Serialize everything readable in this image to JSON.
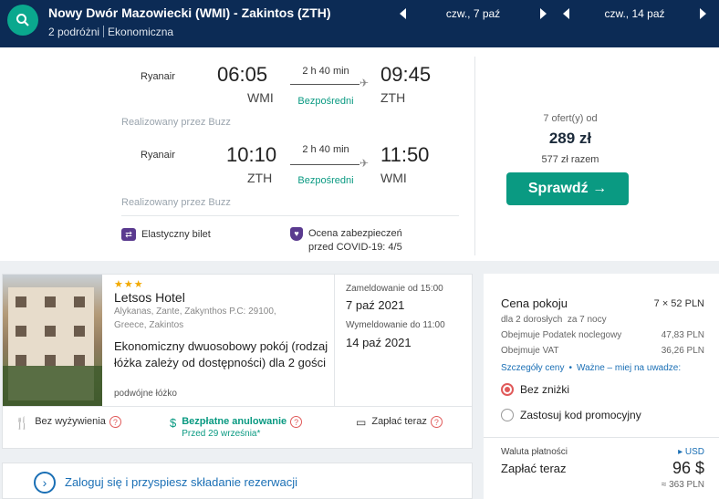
{
  "header": {
    "route": "Nowy Dwór Mazowiecki (WMI) - Zakintos (ZTH)",
    "travellers": "2 podróżni",
    "cabin": "Ekonomiczna",
    "depart_date": "czw., 7 paź",
    "return_date": "czw., 14 paź"
  },
  "flight": {
    "outbound": {
      "airline": "Ryanair",
      "dep_time": "06:05",
      "dep_code": "WMI",
      "duration": "2 h 40 min",
      "stops": "Bezpośredni",
      "arr_time": "09:45",
      "arr_code": "ZTH",
      "operated": "Realizowany przez Buzz"
    },
    "inbound": {
      "airline": "Ryanair",
      "dep_time": "10:10",
      "dep_code": "ZTH",
      "duration": "2 h 40 min",
      "stops": "Bezpośredni",
      "arr_time": "11:50",
      "arr_code": "WMI",
      "operated": "Realizowany przez Buzz"
    },
    "features": {
      "flexible": "Elastyczny bilet",
      "covid_line1": "Ocena zabezpieczeń",
      "covid_line2": "przed COVID-19: 4/5"
    },
    "offers": {
      "count": "7 ofert(y) od",
      "price": "289 zł",
      "total": "577 zł razem",
      "cta": "Sprawdź →"
    }
  },
  "hotel": {
    "stars": "★★★",
    "name": "Letsos Hotel",
    "address_line1": "Alykanas, Zante, Zakynthos P.C: 29100,",
    "address_line2": "Greece, Zakintos",
    "room": "Ekonomiczny dwuosobowy pokój (rodzaj łóżka zależy od dostępności) dla 2 gości",
    "bed": "podwójne łóżko",
    "checkin_label": "Zameldowanie od 15:00",
    "checkin_date": "7 paź 2021",
    "checkout_label": "Wymeldowanie do 11:00",
    "checkout_date": "14 paź 2021",
    "amenities": {
      "meals": "Bez wyżywienia",
      "cancel": "Bezpłatne anulowanie",
      "cancel_sub": "Przed 29 września*",
      "pay": "Zapłać teraz"
    }
  },
  "login": {
    "text": "Zaloguj się i przyspiesz składanie rezerwacji"
  },
  "price_panel": {
    "room_price_label": "Cena pokoju",
    "room_price_value": "7 × 52 PLN",
    "guests": "dla 2 dorosłych  za 7 nocy",
    "tax_label": "Obejmuje Podatek noclegowy",
    "tax_value": "47,83 PLN",
    "vat_label": "Obejmuje VAT",
    "vat_value": "36,26 PLN",
    "details_link": "Szczegóły ceny",
    "important_link": "Ważne – miej na uwadze:",
    "opt_no_discount": "Bez zniżki",
    "opt_promo": "Zastosuj kod promocyjny",
    "currency_label": "Waluta płatności",
    "currency_value": "▸ USD",
    "pay_label": "Zapłać teraz",
    "pay_value": "96 $",
    "pay_alt": "≈ 363 PLN"
  },
  "colors": {
    "header": "#0c2b55",
    "accent": "#0a9a82",
    "link": "#1a6fb5",
    "alert": "#e05a5a"
  }
}
